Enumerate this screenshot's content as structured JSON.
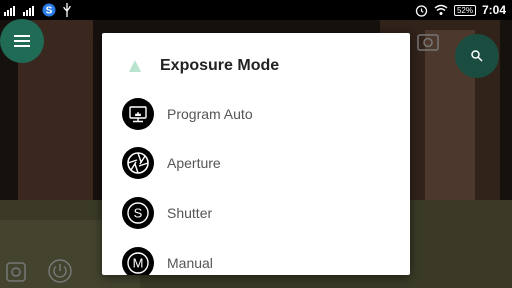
{
  "status_bar": {
    "time": "7:04",
    "battery": "52%"
  },
  "dialog": {
    "title": "Exposure Mode",
    "options": [
      {
        "label": "Program Auto",
        "icon": "program-auto-icon"
      },
      {
        "label": "Aperture",
        "icon": "aperture-icon"
      },
      {
        "label": "Shutter",
        "icon": "shutter-icon"
      },
      {
        "label": "Manual",
        "icon": "manual-icon"
      }
    ]
  },
  "colors": {
    "fab_menu": "#1f6b56",
    "fab_search": "#1a4d40",
    "dialog_bg": "#ffffff",
    "option_text": "#555555"
  }
}
